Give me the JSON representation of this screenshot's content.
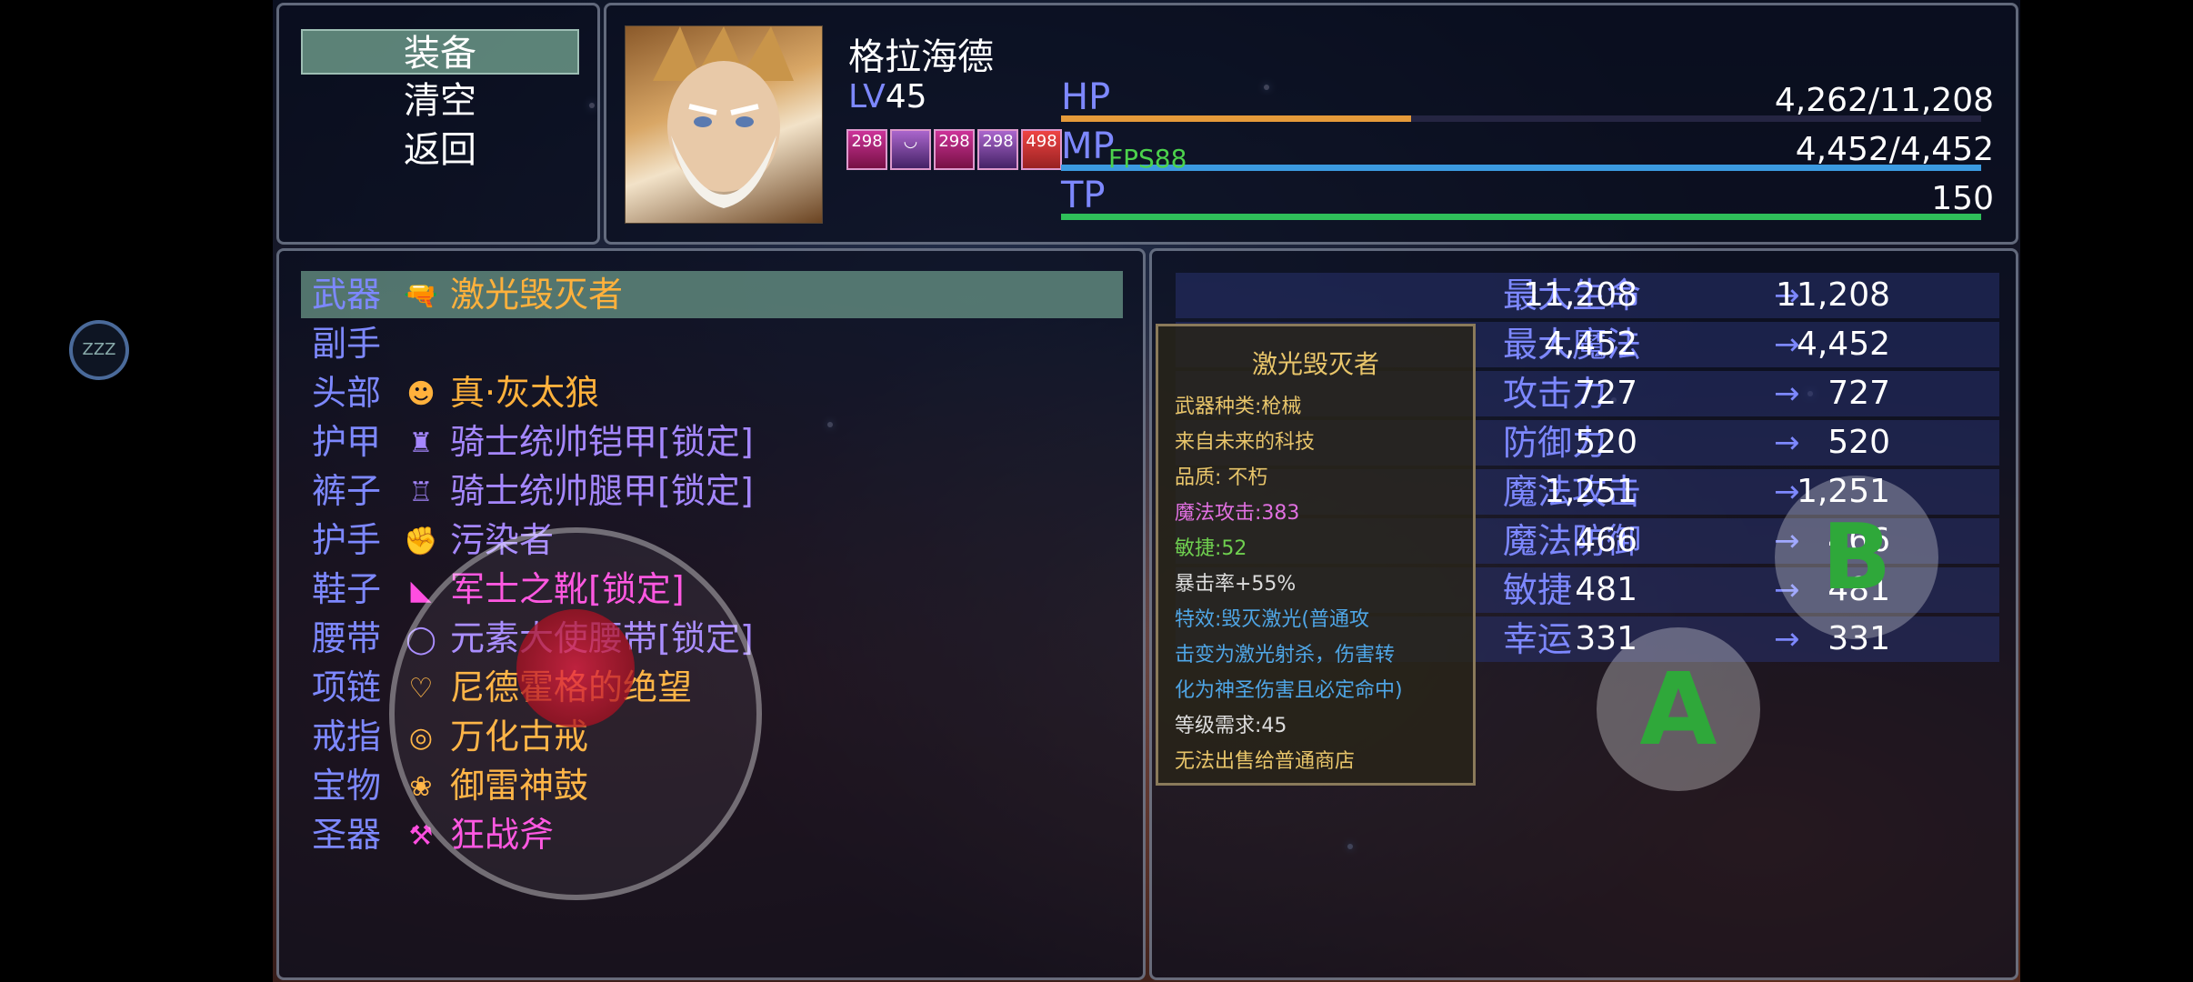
{
  "colors": {
    "system_blue": "#7d88ff",
    "hp_bar": "#e59a3a",
    "mp_bar": "#3b9ae0",
    "tp_bar": "#2fbf5a",
    "purple_item": "#a587ff",
    "orange_item": "#ffb13c",
    "magenta_item": "#ff4ee0",
    "help_gold": "#e8c56a",
    "help_blue": "#4fa6e6",
    "help_magenta": "#e070e0",
    "help_green": "#6fcf4f"
  },
  "command_menu": {
    "items": [
      "装备",
      "清空",
      "返回"
    ],
    "selected_index": 0
  },
  "actor": {
    "name": "格拉海德",
    "level_label": "LV",
    "level": "45",
    "states": [
      {
        "value": "298",
        "icon": "sword-buff-icon"
      },
      {
        "value": "",
        "icon": "grin-face-icon"
      },
      {
        "value": "298",
        "icon": "sword-buff-icon"
      },
      {
        "value": "298",
        "icon": "skull-buff-icon"
      },
      {
        "value": "498",
        "icon": "fire-buff-icon"
      }
    ],
    "hp_label": "HP",
    "hp": "4,262/11,208",
    "hp_ratio": 0.38,
    "mp_label": "MP",
    "mp": "4,452/4,452",
    "mp_ratio": 1.0,
    "tp_label": "TP",
    "tp": "150",
    "tp_ratio": 1.0
  },
  "fps_text": "FPS88",
  "sleep_badge": "ZZZ",
  "equipment": [
    {
      "slot": "武器",
      "icon": "laser-gun-icon",
      "name": "激光毁灭者",
      "color": "#ffb13c",
      "selected": true
    },
    {
      "slot": "副手",
      "icon": "",
      "name": "",
      "color": "#ffffff",
      "selected": false
    },
    {
      "slot": "头部",
      "icon": "wolf-head-icon",
      "name": "真·灰太狼",
      "color": "#ffb13c",
      "selected": false
    },
    {
      "slot": "护甲",
      "icon": "armor-icon",
      "name": "骑士统帅铠甲[锁定]",
      "color": "#a587ff",
      "selected": false
    },
    {
      "slot": "裤子",
      "icon": "greaves-icon",
      "name": "骑士统帅腿甲[锁定]",
      "color": "#a587ff",
      "selected": false
    },
    {
      "slot": "护手",
      "icon": "gauntlet-icon",
      "name": "污染者",
      "color": "#a587ff",
      "selected": false
    },
    {
      "slot": "鞋子",
      "icon": "boot-icon",
      "name": "军士之靴[锁定]",
      "color": "#ff4ee0",
      "selected": false
    },
    {
      "slot": "腰带",
      "icon": "belt-icon",
      "name": "元素大使腰带[锁定]",
      "color": "#a587ff",
      "selected": false
    },
    {
      "slot": "项链",
      "icon": "necklace-icon",
      "name": "尼德霍格的绝望",
      "color": "#ffb13c",
      "selected": false
    },
    {
      "slot": "戒指",
      "icon": "ring-icon",
      "name": "万化古戒",
      "color": "#ffb13c",
      "selected": false
    },
    {
      "slot": "宝物",
      "icon": "drum-icon",
      "name": "御雷神鼓",
      "color": "#ffb13c",
      "selected": false
    },
    {
      "slot": "圣器",
      "icon": "axe-icon",
      "name": "狂战斧",
      "color": "#ff4ee0",
      "selected": false
    }
  ],
  "help_window": {
    "title": "激光毁灭者",
    "lines": [
      {
        "text": "武器种类:枪械",
        "color": "#e8c56a"
      },
      {
        "text": "来自未来的科技",
        "color": "#e8c56a"
      },
      {
        "text": "品质: 不朽",
        "color": "#e8c56a"
      },
      {
        "text": "魔法攻击:383",
        "color": "#e070e0"
      },
      {
        "text": "敏捷:52",
        "color": "#6fcf4f"
      },
      {
        "text": "暴击率+55%",
        "color": "#dddddd"
      },
      {
        "text": "特效:毁灭激光(普通攻",
        "color": "#4fa6e6"
      },
      {
        "text": "击变为激光射杀，伤害转",
        "color": "#4fa6e6"
      },
      {
        "text": "化为神圣伤害且必定命中)",
        "color": "#4fa6e6"
      },
      {
        "text": "等级需求:45",
        "color": "#dddddd"
      },
      {
        "text": "无法出售给普通商店",
        "color": "#e8c56a"
      }
    ]
  },
  "params": [
    {
      "label": "最大生命",
      "old": "11,208",
      "new": "11,208"
    },
    {
      "label": "最大魔法",
      "old": "4,452",
      "new": "4,452"
    },
    {
      "label": "攻击力",
      "old": "727",
      "new": "727"
    },
    {
      "label": "防御力",
      "old": "520",
      "new": "520"
    },
    {
      "label": "魔法攻击",
      "old": "1,251",
      "new": "1,251"
    },
    {
      "label": "魔法防御",
      "old": "466",
      "new": "466"
    },
    {
      "label": "敏捷",
      "old": "481",
      "new": "481"
    },
    {
      "label": "幸运",
      "old": "331",
      "new": "331"
    }
  ],
  "arrow_symbol": "→",
  "virtual_buttons": {
    "a_label": "A",
    "b_label": "B"
  }
}
